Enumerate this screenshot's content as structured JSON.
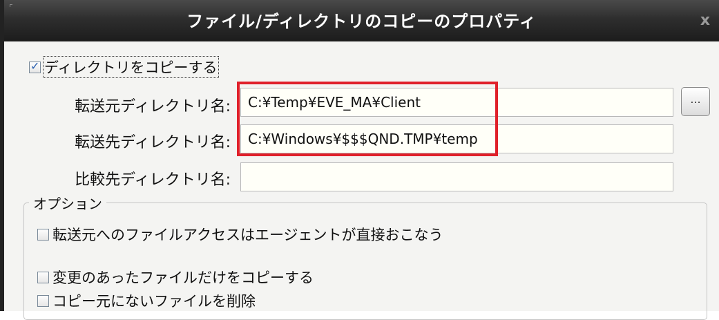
{
  "dialog": {
    "title": "ファイル/ディレクトリのコピーのプロパティ",
    "close_label": "x"
  },
  "copy_directory": {
    "label": "ディレクトリをコピーする",
    "checked": true
  },
  "fields": {
    "source": {
      "label": "転送元ディレクトリ名:",
      "value": "C:¥Temp¥EVE_MA¥Client"
    },
    "destination": {
      "label": "転送先ディレクトリ名:",
      "value": "C:¥Windows¥$$$QND.TMP¥temp"
    },
    "compare": {
      "label": "比較先ディレクトリ名:",
      "value": ""
    },
    "browse_label": "..."
  },
  "options": {
    "legend": "オプション",
    "items": [
      {
        "label": "転送元へのファイルアクセスはエージェントが直接おこなう",
        "checked": false
      },
      {
        "label": "変更のあったファイルだけをコピーする",
        "checked": false
      },
      {
        "label": "コピー元にないファイルを削除",
        "checked": false
      }
    ]
  },
  "colors": {
    "highlight": "#e0202a",
    "titlebar": "#2e2e2e",
    "checkmark": "#2a5fb0"
  }
}
